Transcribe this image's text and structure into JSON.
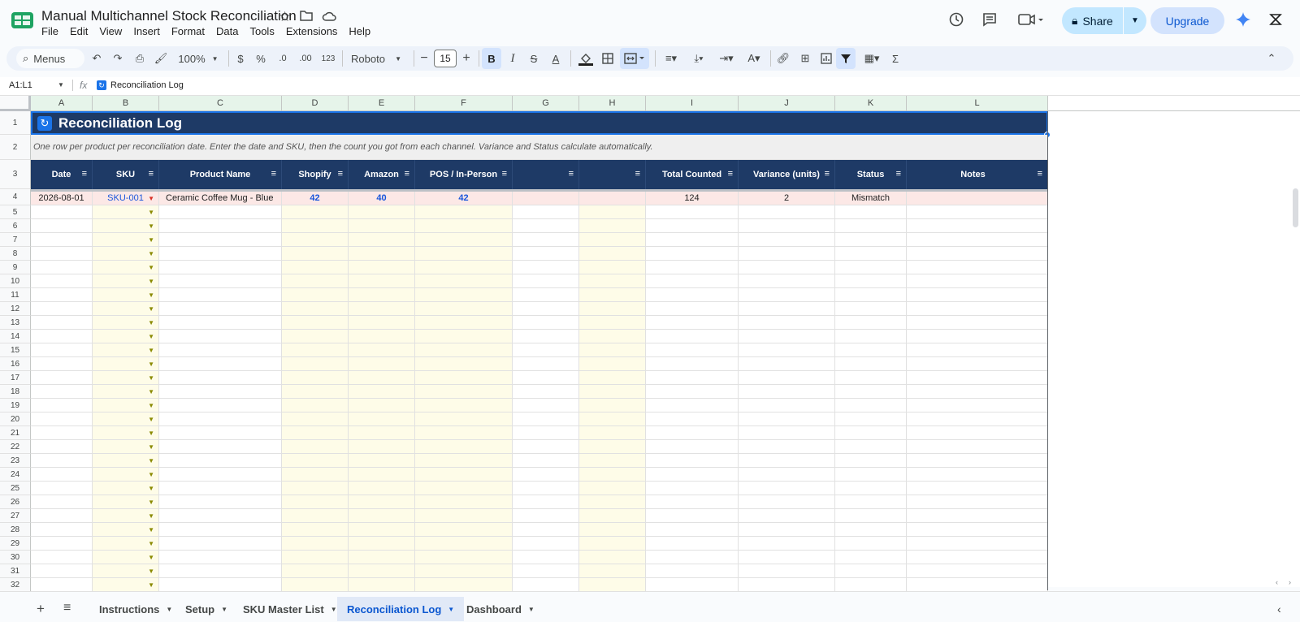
{
  "app": {
    "doc_title": "Manual Multichannel Stock Reconciliation",
    "menus": [
      "File",
      "Edit",
      "View",
      "Insert",
      "Format",
      "Data",
      "Tools",
      "Extensions",
      "Help"
    ],
    "share_label": "Share",
    "upgrade_label": "Upgrade"
  },
  "toolbar": {
    "search_label": "Menus",
    "zoom": "100%",
    "currency": "$",
    "percent": "%",
    "dec_decrease": ".0",
    "dec_increase": ".00",
    "number_format": "123",
    "font": "Roboto",
    "font_size": "15",
    "bold": "B",
    "italic": "I",
    "strike": "S",
    "text_color": "A",
    "sum": "Σ"
  },
  "formula_bar": {
    "name_box": "A1:L1",
    "fx": "fx",
    "content": "Reconciliation Log"
  },
  "columns": [
    "A",
    "B",
    "C",
    "D",
    "E",
    "F",
    "G",
    "H",
    "I",
    "J",
    "K",
    "L"
  ],
  "sheet": {
    "title": "Reconciliation Log",
    "description": "One row per product per reconciliation date. Enter the date and SKU, then the count you got from each channel. Variance and Status calculate automatically.",
    "headers": [
      "Date",
      "SKU",
      "Product Name",
      "Shopify",
      "Amazon",
      "POS / In-Person",
      "",
      "",
      "Total Counted",
      "Variance (units)",
      "Status",
      "Notes"
    ],
    "row4": {
      "date": "2026-08-01",
      "sku": "SKU-001",
      "product": "Ceramic Coffee Mug - Blue",
      "shopify": "42",
      "amazon": "40",
      "pos": "42",
      "total": "124",
      "variance": "2",
      "status": "Mismatch"
    },
    "row_numbers": [
      "1",
      "2",
      "3",
      "4",
      "5",
      "6",
      "7",
      "8",
      "9",
      "10",
      "11",
      "12",
      "13",
      "14",
      "15",
      "16",
      "17",
      "18",
      "19",
      "20",
      "21",
      "22",
      "23",
      "24",
      "25",
      "26",
      "27",
      "28",
      "29",
      "30",
      "31",
      "32"
    ]
  },
  "tabs": [
    "Instructions",
    "Setup",
    "SKU Master List",
    "Reconciliation Log",
    "Dashboard"
  ],
  "colors": {
    "header_bg": "#1e3a66",
    "mismatch_row": "#fce8e6",
    "input_col": "#fefce8",
    "accent": "#0b57d0"
  }
}
